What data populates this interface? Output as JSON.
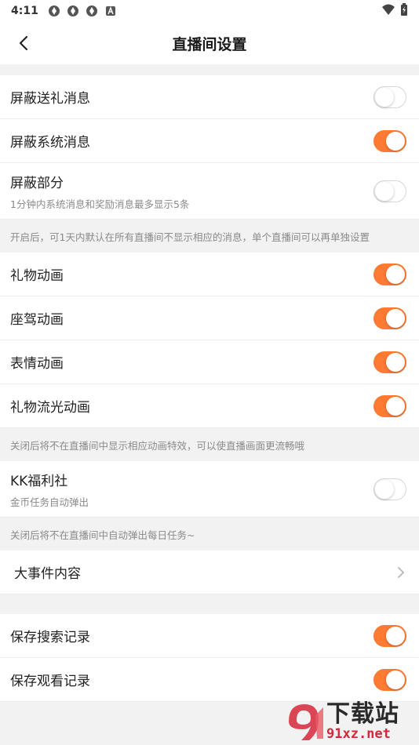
{
  "status_bar": {
    "time": "4:11",
    "notification_icon_count": 3
  },
  "header": {
    "title": "直播间设置"
  },
  "section1": {
    "items": [
      {
        "label": "屏蔽送礼消息",
        "sub": "",
        "on": false
      },
      {
        "label": "屏蔽系统消息",
        "sub": "",
        "on": true
      },
      {
        "label": "屏蔽部分",
        "sub": "1分钟内系统消息和奖励消息最多显示5条",
        "on": false
      }
    ],
    "note": "开启后，可1天内默认在所有直播间不显示相应的消息，单个直播间可以再单独设置"
  },
  "section2": {
    "items": [
      {
        "label": "礼物动画",
        "on": true
      },
      {
        "label": "座驾动画",
        "on": true
      },
      {
        "label": "表情动画",
        "on": true
      },
      {
        "label": "礼物流光动画",
        "on": true
      }
    ],
    "note": "关闭后将不在直播间中显示相应动画特效，可以使直播画面更流畅哦"
  },
  "section3": {
    "item": {
      "label": "KK福利社",
      "sub": "金币任务自动弹出",
      "on": false
    },
    "note": "关闭后将不在直播间中自动弹出每日任务~"
  },
  "section4": {
    "item": {
      "label": "大事件内容"
    }
  },
  "section5": {
    "items": [
      {
        "label": "保存搜索记录",
        "on": true
      },
      {
        "label": "保存观看记录",
        "on": true
      }
    ]
  },
  "watermark": {
    "text_cn": "下载站",
    "text_en": "91xz.net"
  },
  "colors": {
    "accent": "#ff7a33",
    "background": "#f2f2f2",
    "watermark_red": "#d6283a"
  }
}
